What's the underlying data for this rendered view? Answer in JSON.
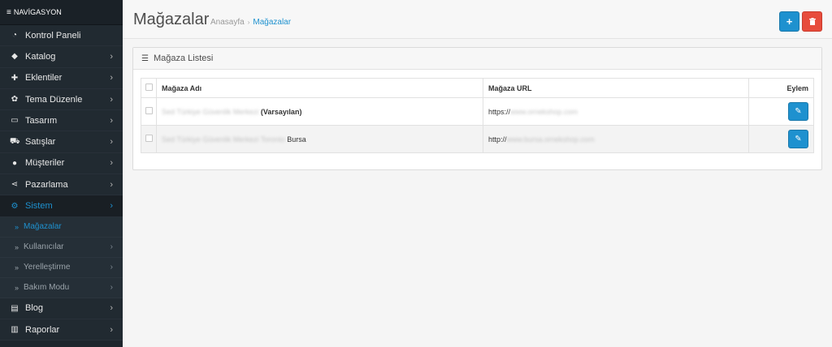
{
  "sidebar": {
    "header": "NAVİGASYON",
    "items": [
      {
        "icon": "dashboard-icon",
        "label": "Kontrol Paneli",
        "chevron": false
      },
      {
        "icon": "tag-icon",
        "label": "Katalog",
        "chevron": true
      },
      {
        "icon": "puzzle-icon",
        "label": "Eklentiler",
        "chevron": true
      },
      {
        "icon": "paint-icon",
        "label": "Tema Düzenle",
        "chevron": true
      },
      {
        "icon": "monitor-icon",
        "label": "Tasarım",
        "chevron": true
      },
      {
        "icon": "cart-icon",
        "label": "Satışlar",
        "chevron": true
      },
      {
        "icon": "user-icon",
        "label": "Müşteriler",
        "chevron": true
      },
      {
        "icon": "share-icon",
        "label": "Pazarlama",
        "chevron": true
      },
      {
        "icon": "gear-icon",
        "label": "Sistem",
        "chevron": true
      }
    ],
    "sub_items": [
      {
        "label": "Mağazalar",
        "chevron": false
      },
      {
        "label": "Kullanıcılar",
        "chevron": true
      },
      {
        "label": "Yerelleştirme",
        "chevron": true
      },
      {
        "label": "Bakım Modu",
        "chevron": true
      }
    ],
    "bottom_items": [
      {
        "icon": "book-icon",
        "label": "Blog",
        "chevron": true
      },
      {
        "icon": "bar-chart-icon",
        "label": "Raporlar",
        "chevron": true
      }
    ]
  },
  "header": {
    "title": "Mağazalar",
    "breadcrumb": [
      "Anasayfa",
      "Mağazalar"
    ],
    "add_icon": "plus-icon",
    "delete_icon": "trash-icon"
  },
  "panel": {
    "title": "Mağaza Listesi",
    "columns": [
      "Mağaza Adı",
      "Mağaza URL",
      "Eylem"
    ],
    "rows": [
      {
        "name_blur": "Sed Türkiye Güvenlik Merkezi",
        "name_suffix": "(Varsayılan)",
        "url_prefix": "https://",
        "url_blur": "www.ornekshop.com"
      },
      {
        "name_blur": "Sed Türkiye Güvenlik Merkezi Toronto",
        "name_suffix": "Bursa",
        "url_prefix": "http://",
        "url_blur": "www.bursa.ornekshop.com"
      }
    ]
  },
  "colors": {
    "accent": "#1e91cf",
    "danger": "#e74c3c",
    "sidebar": "#1e262d"
  }
}
